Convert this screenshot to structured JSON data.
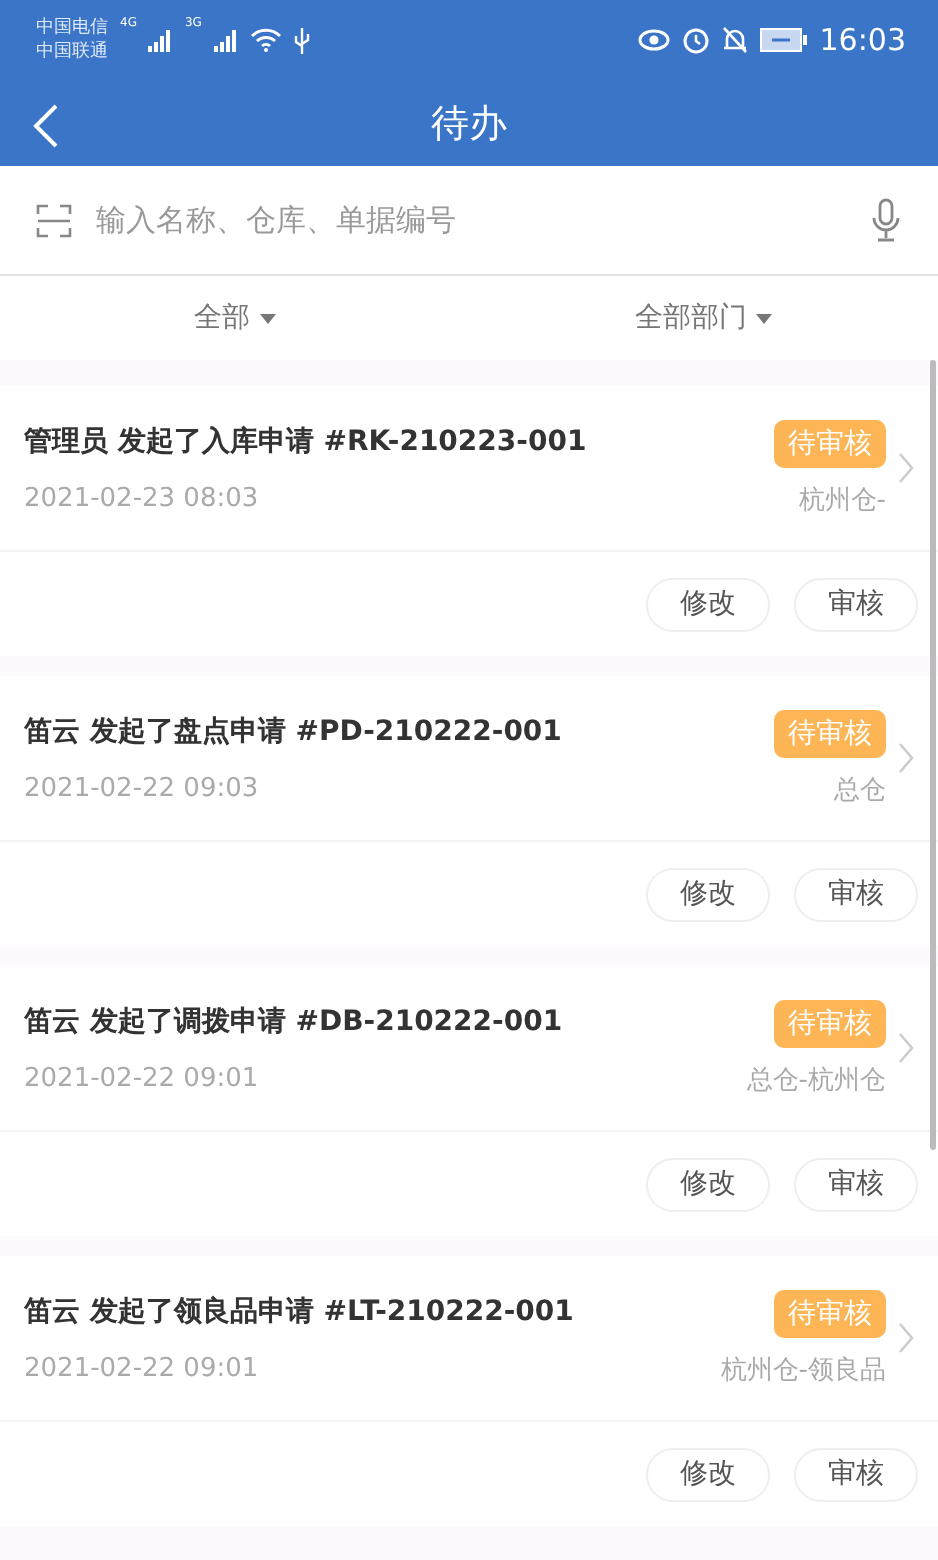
{
  "status_bar": {
    "carriers": [
      "中国电信",
      "中国联通"
    ],
    "network_1": "4G",
    "network_2": "3G",
    "time": "16:03"
  },
  "header": {
    "title": "待办"
  },
  "search": {
    "placeholder": "输入名称、仓库、单据编号"
  },
  "filters": [
    {
      "label": "全部"
    },
    {
      "label": "全部部门"
    }
  ],
  "items": [
    {
      "user": "管理员",
      "action": "发起了入库申请",
      "number": "#RK-210223-001",
      "time": "2021-02-23 08:03",
      "status": "待审核",
      "warehouse": "杭州仓-",
      "buttons": [
        "修改",
        "审核"
      ]
    },
    {
      "user": "笛云",
      "action": "发起了盘点申请",
      "number": "#PD-210222-001",
      "time": "2021-02-22 09:03",
      "status": "待审核",
      "warehouse": "总仓",
      "buttons": [
        "修改",
        "审核"
      ]
    },
    {
      "user": "笛云",
      "action": "发起了调拨申请",
      "number": "#DB-210222-001",
      "time": "2021-02-22 09:01",
      "status": "待审核",
      "warehouse": "总仓-杭州仓",
      "buttons": [
        "修改",
        "审核"
      ]
    },
    {
      "user": "笛云",
      "action": "发起了领良品申请",
      "number": "#LT-210222-001",
      "time": "2021-02-22 09:01",
      "status": "待审核",
      "warehouse": "杭州仓-领良品",
      "buttons": [
        "修改",
        "审核"
      ]
    }
  ]
}
